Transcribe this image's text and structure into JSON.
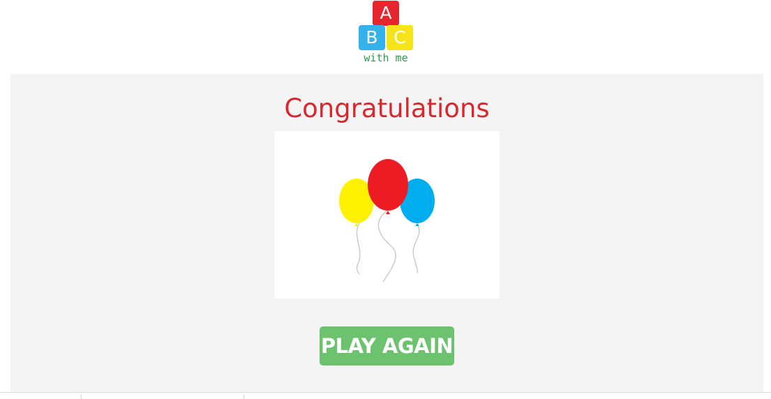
{
  "logo": {
    "letters": [
      "A",
      "B",
      "C"
    ],
    "tagline": "with me",
    "colors": {
      "a_block": "#e5262c",
      "b_block": "#33b3ea",
      "c_block": "#f5e41a",
      "tagline": "#2d9a4a"
    }
  },
  "main": {
    "title": "Congratulations",
    "title_color": "#d9272e",
    "image": {
      "icon": "balloons-illustration",
      "balloon_colors": [
        "#fff200",
        "#ed1c24",
        "#00aeef"
      ]
    },
    "play_again_label": "PLAY AGAIN",
    "button_color": "#6cc26e"
  }
}
